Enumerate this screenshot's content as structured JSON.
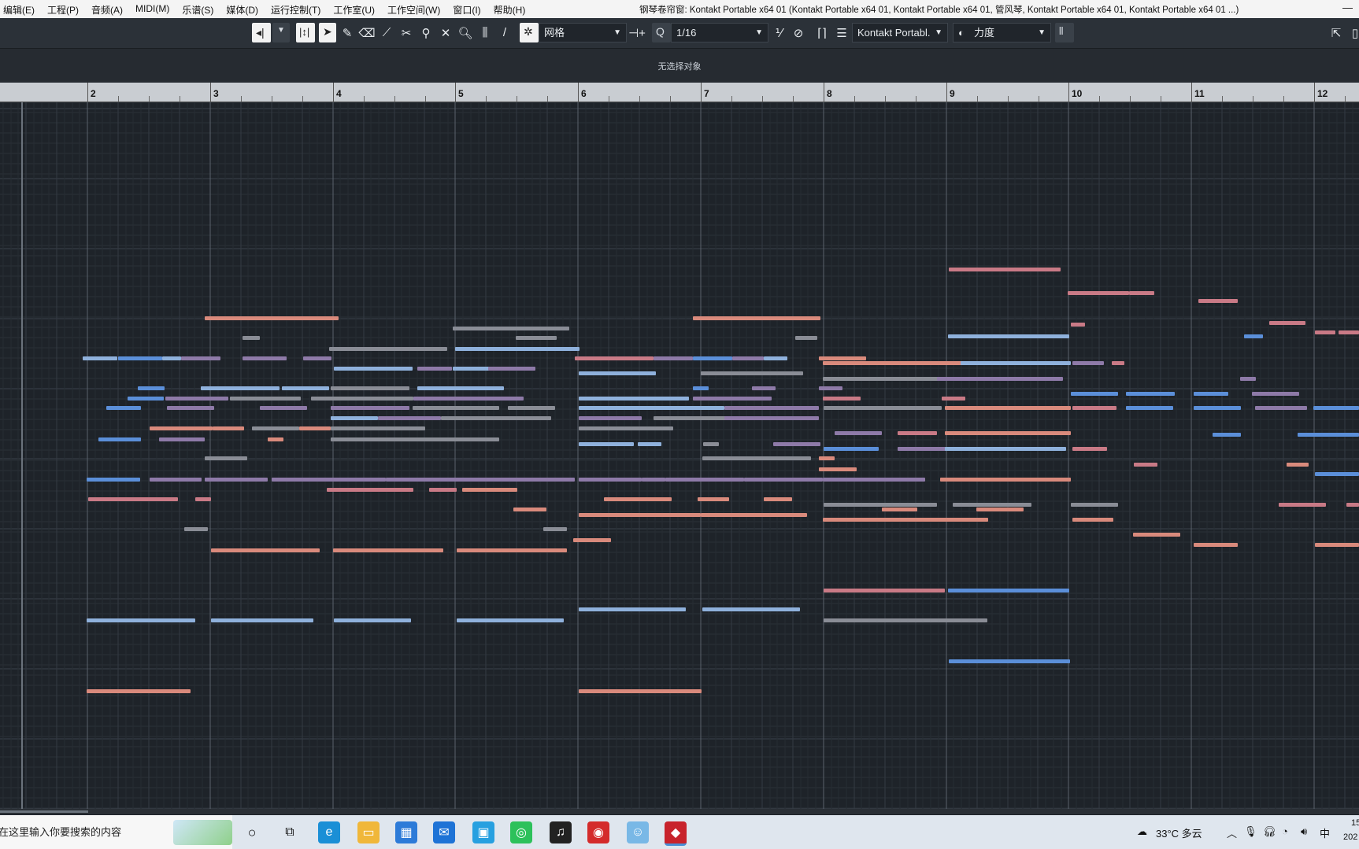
{
  "menubar": {
    "menus": [
      "编辑(E)",
      "工程(P)",
      "音频(A)",
      "MIDI(M)",
      "乐谱(S)",
      "媒体(D)",
      "运行控制(T)",
      "工作室(U)",
      "工作空间(W)",
      "窗口(I)",
      "帮助(H)"
    ],
    "window_title": "钢琴卷帘窗:  Kontakt Portable x64 01 (Kontakt Portable x64 01, Kontakt Portable x64 01, 管风琴, Kontakt Portable x64 01, Kontakt Portable x64 01 ...)",
    "minimize": "—"
  },
  "toolbar": {
    "snap_mode": "网格",
    "quantize": "1/16",
    "quantize_prefix": "Q",
    "instrument": "Kontakt Portabl.",
    "controller": "力度"
  },
  "infobar": {
    "message": "无选择对象"
  },
  "ruler": {
    "bars": [
      "2",
      "3",
      "4",
      "5",
      "6",
      "7",
      "8",
      "9",
      "10",
      "11",
      "12"
    ]
  },
  "colors": {
    "blue": "#5b8fd9",
    "lightblue": "#8fb1dc",
    "pink": "#c97a86",
    "salmon": "#d98a7c",
    "mauve": "#8e7aa8",
    "grey": "#8a8d96"
  },
  "taskbar": {
    "search_placeholder": "在这里输入你要搜索的内容",
    "weather": "33°C 多云",
    "ime": "中",
    "clock_top": "15",
    "clock_bottom": "202"
  }
}
